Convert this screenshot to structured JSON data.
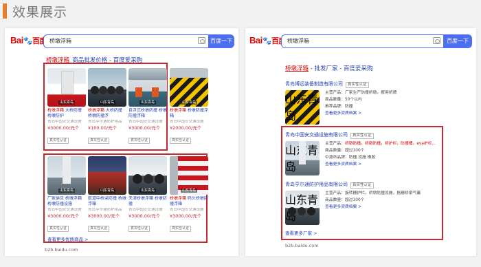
{
  "page": {
    "title": "效果展示"
  },
  "left": {
    "logo": {
      "brand": "Bai",
      "suffix": "百度"
    },
    "search": {
      "query": "桥墩浮箱",
      "button": "百度一下"
    },
    "result_title": {
      "highlight": "桥墩浮箱",
      "rest": "_商品批发价格 - 百度爱采购"
    },
    "products": [
      {
        "title_hl": "桥墩浮箱",
        "title_rest": " 大桥防撞 桥墩防护",
        "seller": "青岛中国安交通设施",
        "price": "¥3000.00/元个",
        "cert": "真实性认证",
        "wm": "山东青岛"
      },
      {
        "title_hl": "桥墩浮箱",
        "title_rest": " 大桥防撞 桥墩防撞浮",
        "seller": "青岛亨尔通防护用品",
        "price": "¥100.00/元个",
        "cert": "真实性认证",
        "wm": "山东青岛"
      },
      {
        "title_hl": "",
        "title_rest": "自浮式桥墩防撞 桥墩防撞浮箱",
        "seller": "青岛中国安交通设施",
        "price": "¥3000.00/元个",
        "cert": "真实性认证",
        "wm": "山东青岛"
      },
      {
        "title_hl": "桥墩浮箱",
        "title_rest": " 桥墩防撞浮箱",
        "seller": "青岛中国安交通设施",
        "price": "¥2000.00/元个",
        "cert": "真实性认证",
        "wm": "山东青岛"
      },
      {
        "title_hl": "",
        "title_rest": "厂家供应 桥墩浮箱 桥墩防撞设施",
        "seller": "青岛中国安交通设施",
        "price": "¥3000.00/元个",
        "cert": "真实性认证",
        "wm": "山东青岛"
      },
      {
        "title_hl": "",
        "title_rest": "航道中桥梁防撞 桥墩浮箱",
        "seller": "青岛亨尔通防护用品",
        "price": "¥3000.00/元个",
        "cert": "真实性认证",
        "wm": "山东青岛"
      },
      {
        "title_hl": "",
        "title_rest": "天津桥墩浮箱 桥墩防撞",
        "seller": "青岛中国安交通设施",
        "price": "¥3000.00/元个",
        "cert": "真实性认证",
        "wm": "山东青岛"
      },
      {
        "title_hl": "桥墩浮箱",
        "title_rest": " 码头桥墩防撞浮箱",
        "seller": "青岛中国安交通设施",
        "price": "¥3000.00/元个",
        "cert": "真实性认证",
        "wm": "山东青岛"
      }
    ],
    "more": "查看更多优质商品 >",
    "footer": "b2b.baidu.com"
  },
  "right": {
    "logo": {
      "brand": "Bai",
      "suffix": "百度"
    },
    "search": {
      "query": "桥墩浮箱",
      "button": "百度一下"
    },
    "result_title": {
      "highlight": "桥墩浮箱",
      "rest": " - 批发厂家 - 百度爱采购"
    },
    "companies": [
      {
        "name": "青岛博远装备制造有限公司",
        "badge": "真实性认证",
        "main_label": "主营产品：",
        "main": "厂家生产防撞桥墩，报用桥牌",
        "qty_label": "商品数量：",
        "qty": "50个以内",
        "rec_label": "推荐品牌：",
        "rec": "防撞",
        "more": "查看更多资质档案 >",
        "wm": "山东青岛"
      },
      {
        "name": "青岛中国安交通设施有限公司",
        "badge": "真实性认证",
        "main_label": "主营产品：",
        "main": "桥墩防撞，桥墩防撞，桥护栏，防撞桶，eva护栏...",
        "qty_label": "商品数量：",
        "qty": "超过100个",
        "rec_label": "中源命品牌：",
        "rec": "防撞  设施  橡胶",
        "more": "查看更多资质档案 >",
        "wm": "山东青岛"
      },
      {
        "name": "青岛亨尔通防护用品有限公司",
        "badge": "真实性认证",
        "main_label": "主营产品：",
        "main": "旋转栅护栏，桥墩防撞设施，格栅桥梁气囊",
        "qty_label": "商品数量：",
        "qty": "超过100个",
        "rec_label": "",
        "rec": "",
        "more": "查看更多资质档案 >",
        "wm": "山东青岛"
      }
    ],
    "more": "查看更多厂家 >",
    "footer": "b2b.baidu.com"
  },
  "colors": {
    "accent": "#e37f2b",
    "highlight_box": "#c8282d",
    "baidu_blue": "#4e6ef2",
    "link": "#2440b3",
    "price": "#c8282d"
  }
}
